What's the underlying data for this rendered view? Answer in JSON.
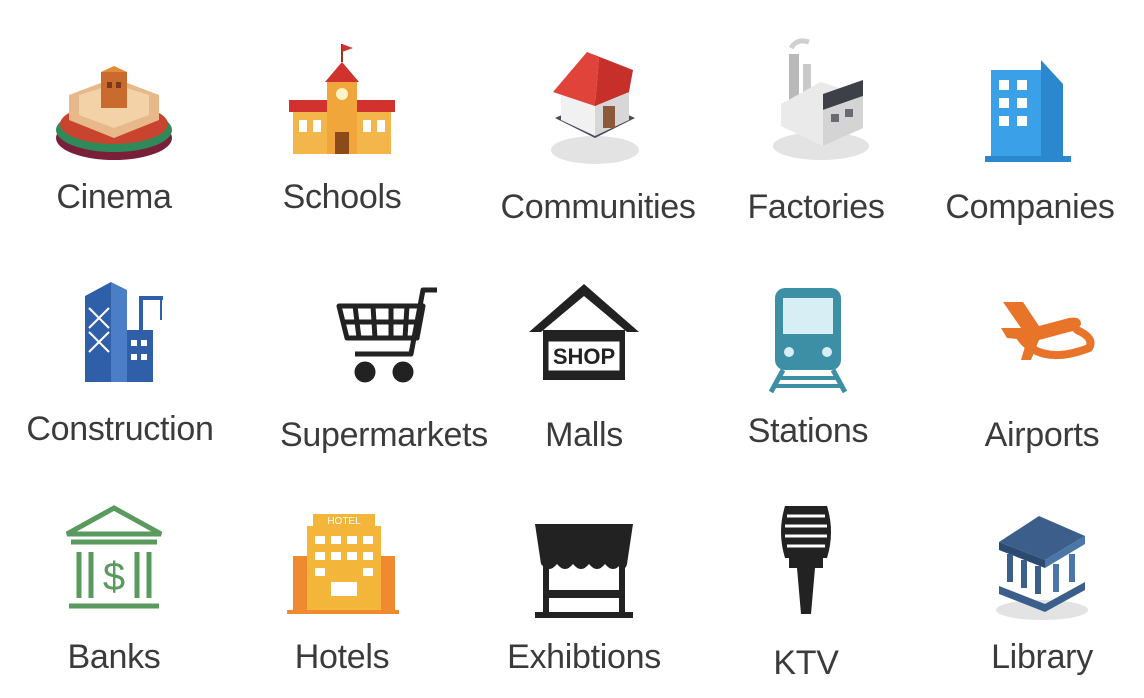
{
  "caption": "",
  "items": [
    {
      "label": "Cinema",
      "icon": "cinema-icon"
    },
    {
      "label": "Schools",
      "icon": "school-icon"
    },
    {
      "label": "Communities",
      "icon": "house-icon"
    },
    {
      "label": "Factories",
      "icon": "factory-icon"
    },
    {
      "label": "Companies",
      "icon": "office-building-icon"
    },
    {
      "label": "Construction",
      "icon": "construction-icon"
    },
    {
      "label": "Supermarkets",
      "icon": "shopping-cart-icon"
    },
    {
      "label": "Malls",
      "icon": "shop-icon"
    },
    {
      "label": "Stations",
      "icon": "train-icon"
    },
    {
      "label": "Airports",
      "icon": "airplane-icon"
    },
    {
      "label": "Banks",
      "icon": "bank-icon"
    },
    {
      "label": "Hotels",
      "icon": "hotel-icon"
    },
    {
      "label": "Exhibtions",
      "icon": "exhibition-stand-icon"
    },
    {
      "label": "KTV",
      "icon": "microphone-icon"
    },
    {
      "label": "Library",
      "icon": "library-icon"
    }
  ],
  "colors": {
    "label_text": "#3b3b3b",
    "company_blue": "#3aa0e8",
    "construction_blue": "#2f5fa8",
    "airport_orange": "#e8742a",
    "bank_green": "#5a9a5e",
    "station_teal": "#3d8fa6",
    "library_navy": "#3b5f8a"
  }
}
